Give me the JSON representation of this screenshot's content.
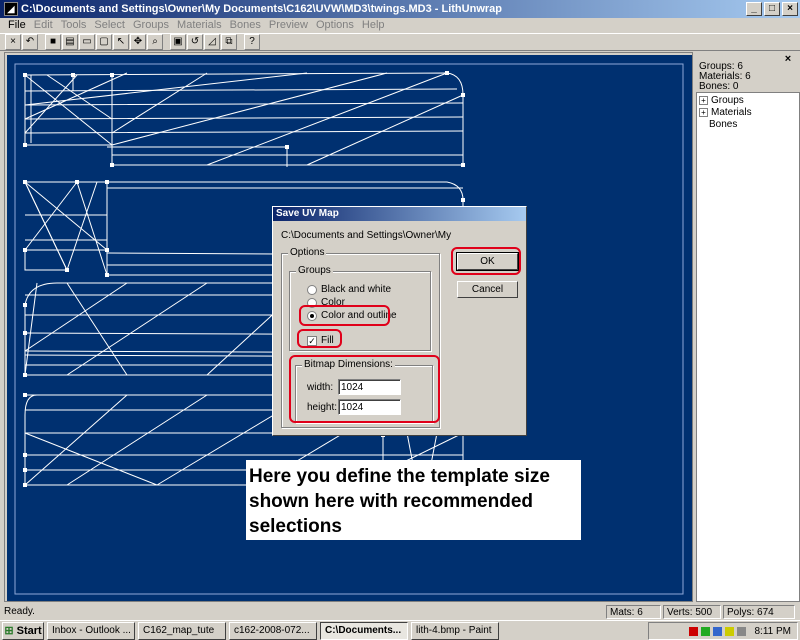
{
  "window": {
    "title": "C:\\Documents and Settings\\Owner\\My Documents\\C162\\UVW\\MD3\\twings.MD3 - LithUnwrap",
    "minimize": "_",
    "maximize": "□",
    "close": "×"
  },
  "menu": [
    "File",
    "Edit",
    "Tools",
    "Select",
    "Groups",
    "Materials",
    "Bones",
    "Preview",
    "Options",
    "Help"
  ],
  "toolbar": [
    "×",
    "↶",
    "■",
    "▤",
    "▭",
    "▢",
    "↖",
    "✥",
    "⌕",
    "▣",
    "↺",
    "◿",
    "⧉",
    "?"
  ],
  "side_panel": {
    "close": "×",
    "groups_info": "Groups: 6",
    "materials_info": "Materials: 6",
    "bones_info": "Bones: 0",
    "tree": [
      {
        "label": "Groups",
        "expander": "+"
      },
      {
        "label": "Materials",
        "expander": "+"
      },
      {
        "label": "Bones",
        "expander": ""
      }
    ]
  },
  "dialog": {
    "title": "Save UV Map",
    "path": "C:\\Documents and Settings\\Owner\\My",
    "options_label": "Options",
    "groups_label": "Groups",
    "radio_bw": "Black and white",
    "radio_color": "Color",
    "radio_outline": "Color and outline",
    "fill_label": "Fill",
    "fill_check": "✓",
    "bitmap_label": "Bitmap Dimensions:",
    "width_label": "width:",
    "width_value": "1024",
    "height_label": "height:",
    "height_value": "1024",
    "ok": "OK",
    "cancel": "Cancel"
  },
  "annotation": {
    "line1": "Here you define the template size",
    "line2": "shown here with recommended",
    "line3": "selections"
  },
  "status": {
    "text": "Ready.",
    "mats": "Mats: 6",
    "verts": "Verts: 500",
    "polys": "Polys: 674"
  },
  "taskbar": {
    "start": "Start",
    "tasks": [
      "Inbox - Outlook ...",
      "C162_map_tute",
      "c162-2008-072...",
      "C:\\Documents...",
      "lith-4.bmp - Paint"
    ],
    "clock": "8:11 PM"
  },
  "colors": {
    "canvas": "#003070",
    "highlight": "#e0001a",
    "titlebar": "#0a246a"
  }
}
